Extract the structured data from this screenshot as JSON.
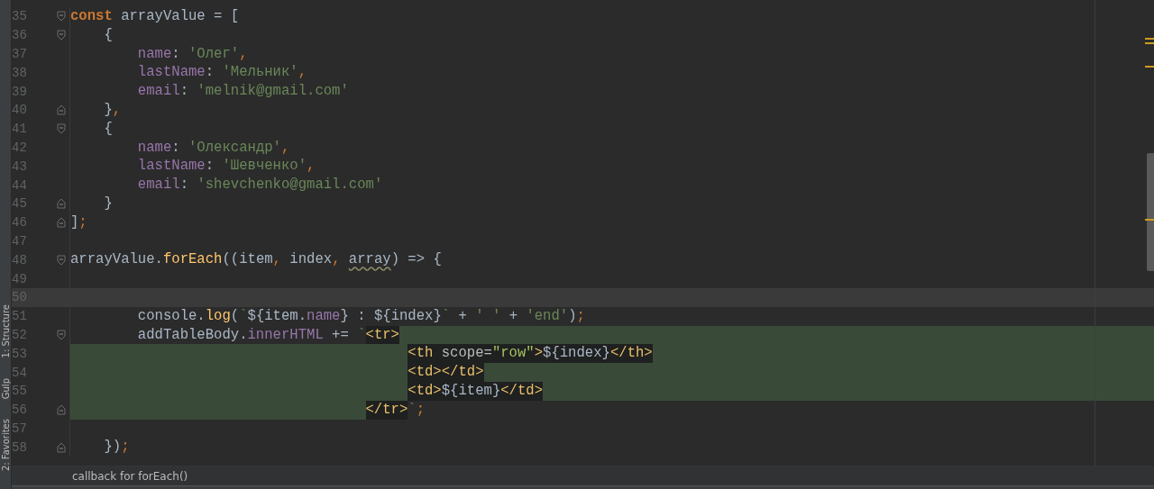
{
  "tool_strip": {
    "labels": [
      "1: Structure",
      "Gulp",
      "2: Favorites"
    ]
  },
  "editor": {
    "lines": [
      {
        "number": "35",
        "kind": "top",
        "fold_start": true,
        "tokens": [
          {
            "text": "const",
            "kind": "keyword"
          },
          {
            "text": " arrayValue = [",
            "kind": "plain"
          }
        ]
      },
      {
        "number": "36",
        "kind": "object",
        "fold_start": true,
        "tokens": [
          {
            "text": "{",
            "kind": "plain"
          }
        ]
      },
      {
        "number": "37",
        "kind": "property",
        "tokens": [
          {
            "text": "name",
            "kind": "prop"
          },
          {
            "text": ": ",
            "kind": "plain"
          },
          {
            "text": "'Олег'",
            "kind": "string"
          },
          {
            "text": ",",
            "kind": "punct"
          }
        ]
      },
      {
        "number": "38",
        "kind": "property",
        "tokens": [
          {
            "text": "lastName",
            "kind": "prop"
          },
          {
            "text": ": ",
            "kind": "plain"
          },
          {
            "text": "'Мельник'",
            "kind": "string"
          },
          {
            "text": ",",
            "kind": "punct"
          }
        ]
      },
      {
        "number": "39",
        "kind": "property",
        "tokens": [
          {
            "text": "email",
            "kind": "prop"
          },
          {
            "text": ": ",
            "kind": "plain"
          },
          {
            "text": "'melnik@gmail.com'",
            "kind": "string"
          }
        ]
      },
      {
        "number": "40",
        "kind": "object",
        "fold_end": true,
        "tokens": [
          {
            "text": "}",
            "kind": "plain"
          },
          {
            "text": ",",
            "kind": "punct"
          }
        ]
      },
      {
        "number": "41",
        "kind": "object",
        "fold_start": true,
        "tokens": [
          {
            "text": "{",
            "kind": "plain"
          }
        ]
      },
      {
        "number": "42",
        "kind": "property",
        "tokens": [
          {
            "text": "name",
            "kind": "prop"
          },
          {
            "text": ": ",
            "kind": "plain"
          },
          {
            "text": "'Олександр'",
            "kind": "string"
          },
          {
            "text": ",",
            "kind": "punct"
          }
        ]
      },
      {
        "number": "43",
        "kind": "property",
        "tokens": [
          {
            "text": "lastName",
            "kind": "prop"
          },
          {
            "text": ": ",
            "kind": "plain"
          },
          {
            "text": "'Шевченко'",
            "kind": "string"
          },
          {
            "text": ",",
            "kind": "punct"
          }
        ]
      },
      {
        "number": "44",
        "kind": "property",
        "tokens": [
          {
            "text": "email",
            "kind": "prop"
          },
          {
            "text": ": ",
            "kind": "plain"
          },
          {
            "text": "'shevchenko@gmail.com'",
            "kind": "string"
          }
        ]
      },
      {
        "number": "45",
        "kind": "object",
        "fold_end": true,
        "tokens": [
          {
            "text": "}",
            "kind": "plain"
          }
        ]
      },
      {
        "number": "46",
        "kind": "top",
        "fold_end": true,
        "tokens": [
          {
            "text": "]",
            "kind": "plain"
          },
          {
            "text": ";",
            "kind": "punct"
          }
        ]
      },
      {
        "number": "47",
        "kind": "top"
      },
      {
        "number": "48",
        "kind": "top",
        "fold_start": true,
        "tokens": [
          {
            "text": "arrayValue.",
            "kind": "plain"
          },
          {
            "text": "forEach",
            "kind": "func"
          },
          {
            "text": "((item",
            "kind": "plain"
          },
          {
            "text": ",",
            "kind": "punct"
          },
          {
            "text": " index",
            "kind": "plain"
          },
          {
            "text": ", ",
            "kind": "punct"
          },
          {
            "text": "array",
            "kind": "plain",
            "warning": true
          },
          {
            "text": ") => {",
            "kind": "plain"
          }
        ]
      },
      {
        "number": "49",
        "kind": "top"
      },
      {
        "number": "50",
        "kind": "top",
        "current": true
      },
      {
        "number": "51",
        "kind": "property",
        "tokens": [
          {
            "text": "console.",
            "kind": "plain"
          },
          {
            "text": "log",
            "kind": "func"
          },
          {
            "text": "(",
            "kind": "plain"
          },
          {
            "text": "`",
            "kind": "string"
          },
          {
            "text": "${item.",
            "kind": "plain"
          },
          {
            "text": "name",
            "kind": "prop"
          },
          {
            "text": "} : ${index}",
            "kind": "plain"
          },
          {
            "text": "`",
            "kind": "string"
          },
          {
            "text": " + ",
            "kind": "plain"
          },
          {
            "text": "' '",
            "kind": "string"
          },
          {
            "text": " + ",
            "kind": "plain"
          },
          {
            "text": "'end'",
            "kind": "string"
          },
          {
            "text": ")",
            "kind": "plain"
          },
          {
            "text": ";",
            "kind": "punct"
          }
        ]
      },
      {
        "number": "52",
        "kind": "property",
        "fold_start": true,
        "injected": true,
        "tokens": [
          {
            "text": "addTableBody.",
            "kind": "plain"
          },
          {
            "text": "innerHTML",
            "kind": "prop"
          },
          {
            "text": " += ",
            "kind": "plain"
          },
          {
            "text": "`",
            "kind": "string"
          },
          {
            "text": "<tr>",
            "kind": "tag",
            "embedded": true
          }
        ]
      },
      {
        "number": "53",
        "kind": "html_inner",
        "injected": true,
        "tokens": [
          {
            "text": "<th",
            "kind": "tag",
            "embedded": true
          },
          {
            "text": " scope=",
            "kind": "attr",
            "embedded": true
          },
          {
            "text": "\"row\"",
            "kind": "attrval",
            "embedded": true
          },
          {
            "text": ">",
            "kind": "tag",
            "embedded": true
          },
          {
            "text": "${index}",
            "kind": "plain",
            "embedded": true
          },
          {
            "text": "</th>",
            "kind": "tag",
            "embedded": true
          }
        ]
      },
      {
        "number": "54",
        "kind": "html_inner",
        "injected": true,
        "tokens": [
          {
            "text": "<td></td>",
            "kind": "tag",
            "embedded": true
          }
        ]
      },
      {
        "number": "55",
        "kind": "html_inner",
        "injected": true,
        "tokens": [
          {
            "text": "<td>",
            "kind": "tag",
            "embedded": true
          },
          {
            "text": "${item}",
            "kind": "plain",
            "embedded": true
          },
          {
            "text": "</td>",
            "kind": "tag",
            "embedded": true
          }
        ]
      },
      {
        "number": "56",
        "kind": "html_close",
        "fold_end": true,
        "tokens": [
          {
            "text": "</tr>",
            "kind": "tag",
            "embedded": true
          },
          {
            "text": "`",
            "kind": "string"
          },
          {
            "text": ";",
            "kind": "punct"
          }
        ]
      },
      {
        "number": "57",
        "kind": "top"
      },
      {
        "number": "58",
        "kind": "object",
        "fold_end": true,
        "tokens": [
          {
            "text": "})",
            "kind": "plain"
          },
          {
            "text": ";",
            "kind": "punct"
          }
        ]
      }
    ]
  },
  "status_bar": {
    "text": "callback for forEach()"
  }
}
